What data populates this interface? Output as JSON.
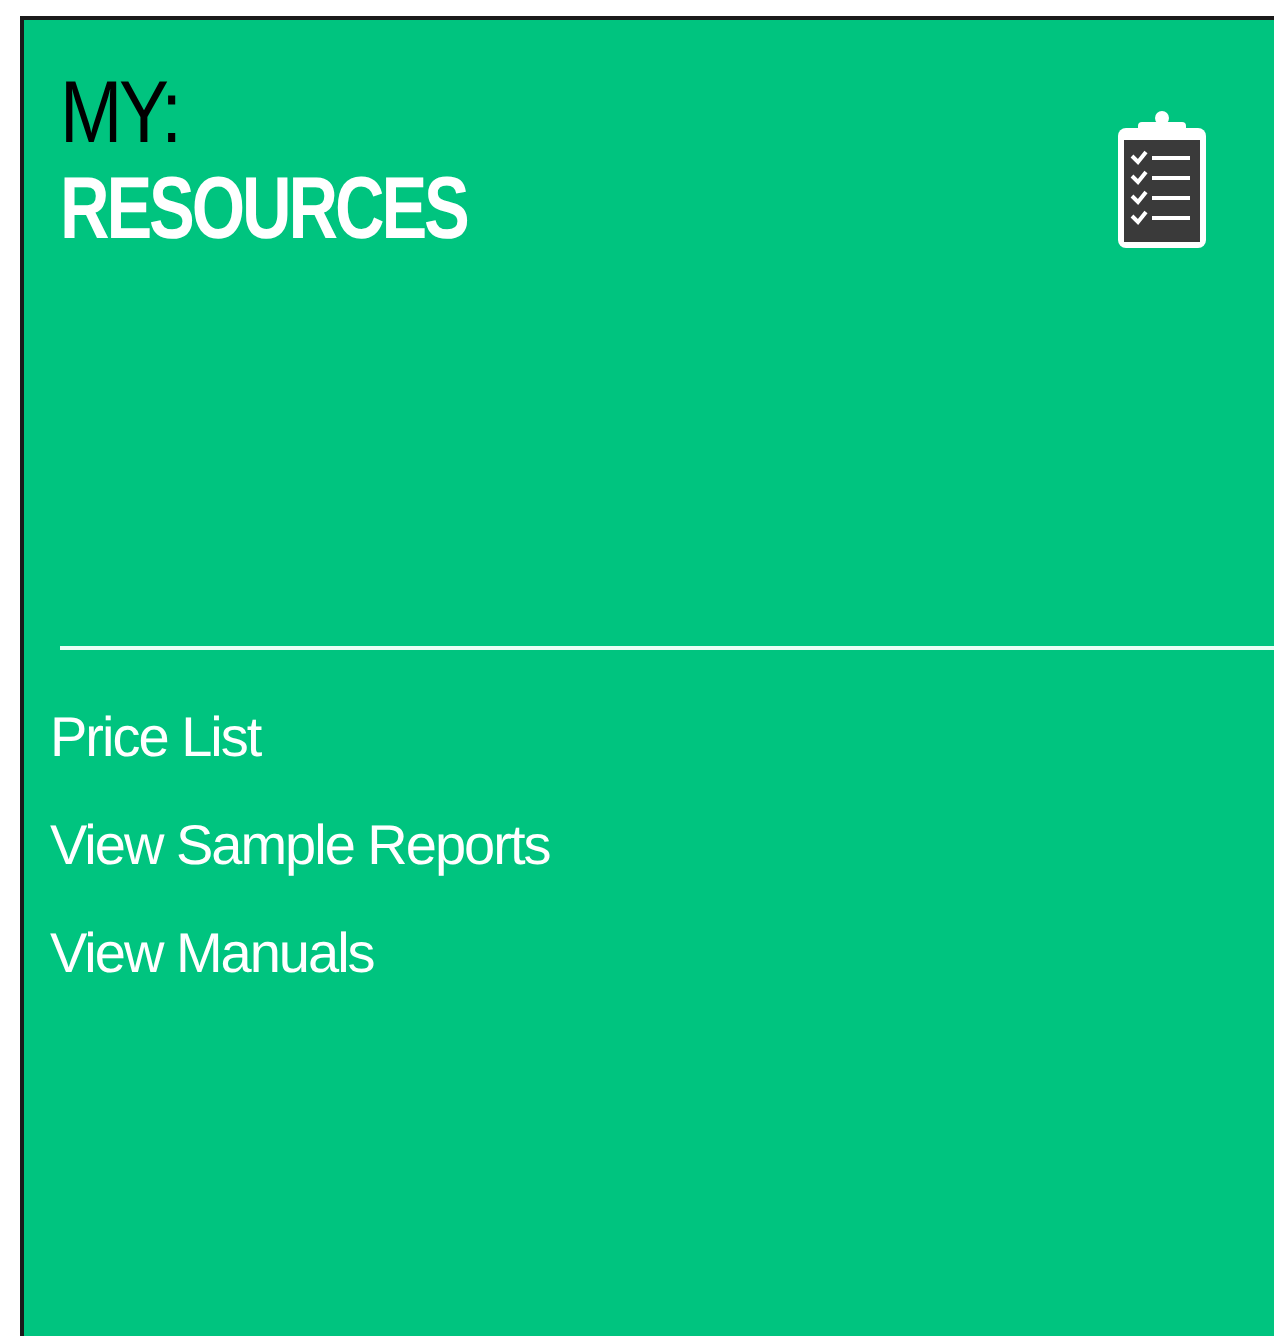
{
  "title": {
    "prefix": "MY:",
    "heading": "RESOURCES"
  },
  "links": [
    "Price List",
    "View Sample Reports",
    "View Manuals"
  ]
}
